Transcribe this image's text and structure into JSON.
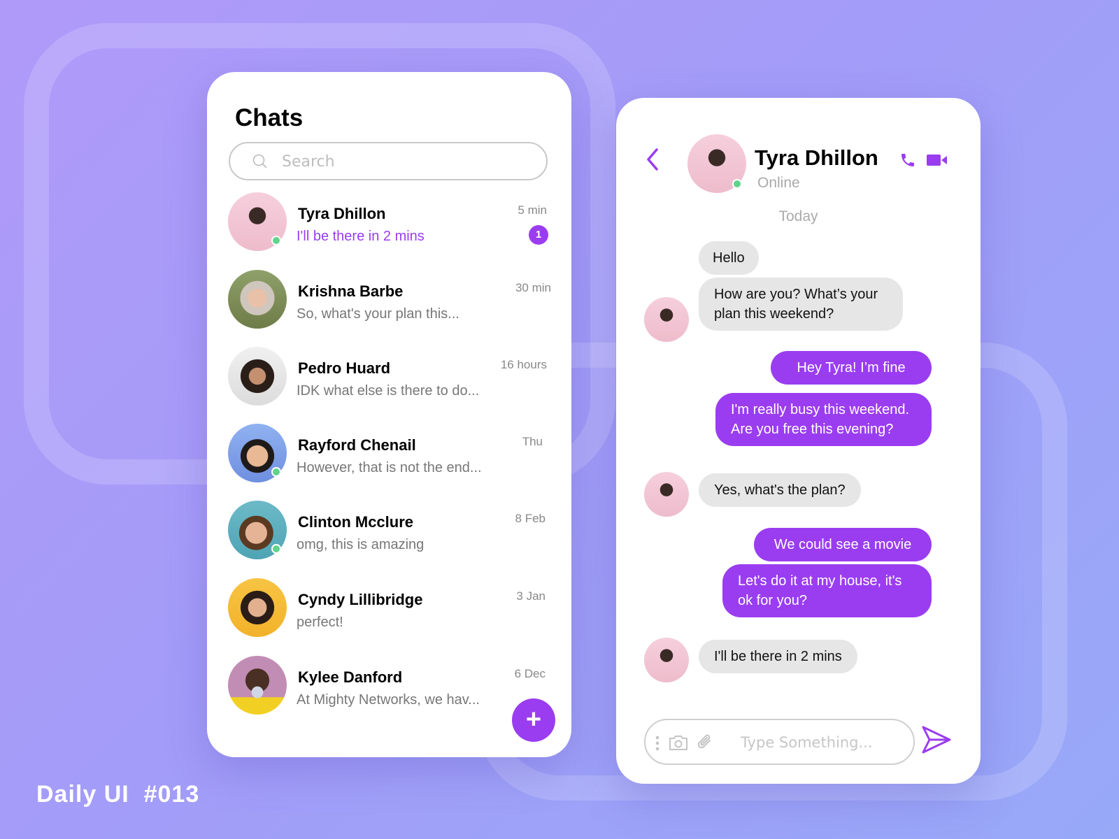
{
  "colors": {
    "accent": "#9a3df0",
    "online": "#5fd48a",
    "incoming_bubble": "#e6e6e6"
  },
  "chat_list": {
    "title": "Chats",
    "search": {
      "placeholder": "Search",
      "icon": "search-icon"
    },
    "items": [
      {
        "name": "Tyra Dhillon",
        "message": "I'll be there in 2 mins",
        "time": "5 min",
        "unread": "1",
        "online": true
      },
      {
        "name": "Krishna Barbe",
        "message": "So, what's your plan this...",
        "time": "30 min",
        "online": false
      },
      {
        "name": "Pedro Huard",
        "message": "IDK what else is there to do...",
        "time": "16 hours",
        "online": false
      },
      {
        "name": "Rayford Chenail",
        "message": "However, that is not the end...",
        "time": "Thu",
        "online": true
      },
      {
        "name": "Clinton Mcclure",
        "message": "omg, this is amazing",
        "time": "8 Feb",
        "online": true
      },
      {
        "name": "Cyndy Lillibridge",
        "message": "perfect!",
        "time": "3 Jan",
        "online": false
      },
      {
        "name": "Kylee Danford",
        "message": "At Mighty Networks, we hav...",
        "time": "6 Dec",
        "online": false
      }
    ],
    "fab_label": "+"
  },
  "conversation": {
    "contact_name": "Tyra Dhillon",
    "status": "Online",
    "date_separator": "Today",
    "messages": [
      {
        "from": "them",
        "text": "Hello"
      },
      {
        "from": "them",
        "text": "How are you? What’s your plan this weekend?"
      },
      {
        "from": "me",
        "text": "Hey Tyra! I’m fine"
      },
      {
        "from": "me",
        "text": "I'm really busy this weekend. Are you free this evening?"
      },
      {
        "from": "them",
        "text": "Yes, what's the plan?"
      },
      {
        "from": "me",
        "text": "We could see a movie"
      },
      {
        "from": "me",
        "text": "Let's do it at my house, it's ok for you?"
      },
      {
        "from": "them",
        "text": "I'll be there in 2 mins"
      }
    ],
    "input_placeholder": "Type Something..."
  },
  "footer": {
    "label": "Daily UI  #013"
  }
}
